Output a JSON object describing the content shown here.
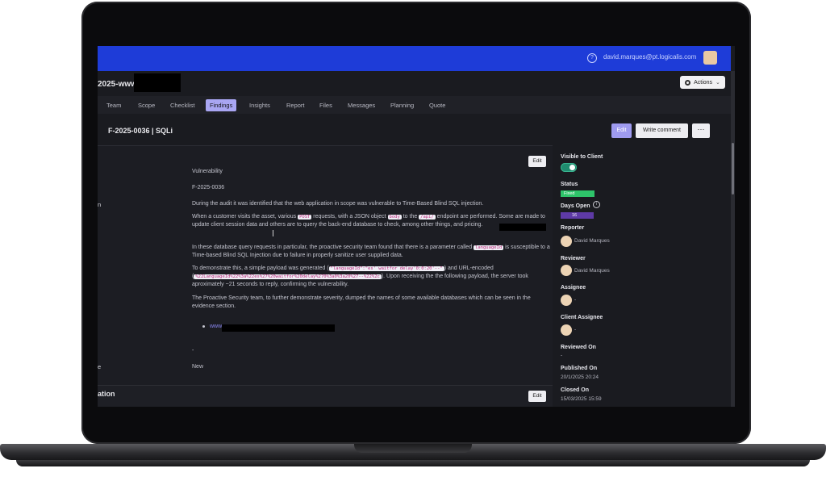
{
  "topbar": {
    "help_icon": "?",
    "user_email": "david.marques@pt.logicalis.com"
  },
  "project": {
    "title": "2025-www"
  },
  "actions": {
    "label": "Actions",
    "chevron": "⌄"
  },
  "tabs": [
    "Team",
    "Scope",
    "Checklist",
    "Findings",
    "Insights",
    "Report",
    "Files",
    "Messages",
    "Planning",
    "Quote"
  ],
  "finding": {
    "title": "F-2025-0036 | SQLi",
    "edit_label": "Edit",
    "comment_label": "Write comment",
    "more_label": "···"
  },
  "panel": {
    "edit_label": "Edit",
    "label_n": "n",
    "label_e": "e",
    "type": "Vulnerability",
    "id": "F-2025-0036",
    "p1": "During the audit it was identified that the web application in scope was vulnerable to Time-Based Blind SQL injection.",
    "p2a": "When a customer visits the asset, various ",
    "code_post": "POST",
    "p2b": " requests, with a JSON object ",
    "code_body": "body",
    "p2c": " to the ",
    "code_path": "/api/",
    "p2d": " endpoint are performed. Some are made to update client session data and others are to query the back-end database to check, among other things,",
    "p2e": " and pricing.",
    "p3a": "In these database query requests in particular, the proactive security team found that there is a parameter called ",
    "code_param": "languageId",
    "p3b": " is susceptible to a Time-based Blind SQL Injection due to failure in properly sanitize user supplied data.",
    "p4a": "To demonstrate this, a simple payload was generated (",
    "code_payload": "\"languageId\":\"es' waitfor delay'0:0:20'--\"",
    "p4b": ") and URL-encoded (",
    "code_encoded": "%22LanguageId%22%3a%22es%27%20waitfor%20delay%270%3a0%3a20%27--%22%2c",
    "p4c": "). Upon receiving the the following payload, the server took aproximately ~21 seconds to reply, confirming the vulnerability.",
    "p5": "The Proactive Security team, to further demonstrate severity, dumped the names of some available databases which can be seen in the evidence section.",
    "link_prefix": "www.",
    "dash": "-",
    "state": "New",
    "section_title": "ation"
  },
  "sidebar": {
    "visible_label": "Visible to Client",
    "status_label": "Status",
    "status_value": "Fixed",
    "days_label": "Days Open",
    "days_value": "16",
    "reporter_label": "Reporter",
    "reporter_name": "David Marques",
    "reviewer_label": "Reviewer",
    "reviewer_name": "David Marques",
    "assignee_label": "Assignee",
    "assignee_value": "-",
    "client_assignee_label": "Client Assignee",
    "client_assignee_value": "-",
    "reviewed_on_label": "Reviewed On",
    "reviewed_on_value": "-",
    "published_on_label": "Published On",
    "published_on_value": "20/1/2025 20:24",
    "closed_on_label": "Closed On",
    "closed_on_value": "15/03/2025 15:59"
  },
  "colors": {
    "topbar": "#1e3cd8",
    "accent": "#a9a6f3",
    "status_fixed": "#2ec46a",
    "days_badge": "#5e3aa6"
  }
}
